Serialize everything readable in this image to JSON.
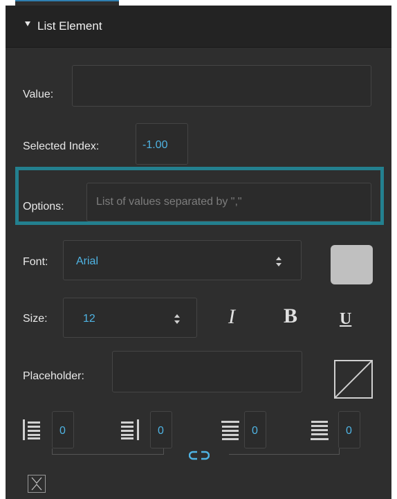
{
  "header": {
    "title": "List Element"
  },
  "value_field": {
    "label": "Value:",
    "value": ""
  },
  "selected_index": {
    "label": "Selected Index:",
    "value": "-1.00"
  },
  "options_field": {
    "label": "Options:",
    "placeholder": "List of values separated by \",\""
  },
  "font": {
    "label": "Font:",
    "value": "Arial"
  },
  "size": {
    "label": "Size:",
    "value": "12"
  },
  "text_style": {
    "italic": "I",
    "bold": "B",
    "underline": "U"
  },
  "placeholder_field": {
    "label": "Placeholder:",
    "value": ""
  },
  "spacing": {
    "left": "0",
    "right": "0",
    "top": "0",
    "bottom": "0"
  },
  "colors": {
    "panel_bg": "#2e2e2e",
    "header_bg": "#232323",
    "accent_value": "#4fb4e4",
    "highlight_border": "#23808f",
    "swatch": "#c0c0c0"
  },
  "icons": {
    "collapse": "triangle-down-icon",
    "align_left": "align-left-icon",
    "align_right": "align-right-icon",
    "align_top": "align-top-icon",
    "align_bottom": "align-bottom-icon",
    "link": "link-icon",
    "no_fill": "no-fill-icon",
    "collapse_x": "collapse-icon"
  }
}
